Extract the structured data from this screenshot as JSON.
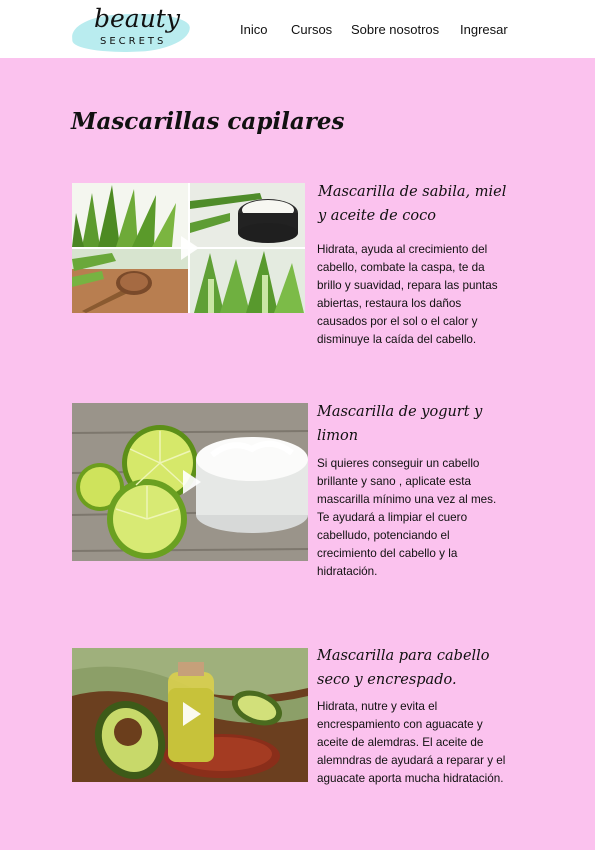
{
  "brand": {
    "name": "beauty",
    "tagline": "SECRETS"
  },
  "nav": {
    "items": [
      "Inico",
      "Cursos",
      "Sobre nosotros",
      "Ingresar"
    ]
  },
  "page": {
    "title": "Mascarillas capilares"
  },
  "colors": {
    "background": "#fbc2ee",
    "header": "#ffffff",
    "logo_splash": "#b9ecef",
    "text": "#111111"
  },
  "cards": [
    {
      "title": "Mascarilla de sabila, miel y aceite de coco",
      "description": "Hidrata, ayuda al crecimiento del cabello, combate la caspa, te da brillo y suavidad, repara las puntas abiertas, restaura los daños causados por el sol o el calor y disminuye la caída del cabello.",
      "play_icon": "play-icon"
    },
    {
      "title": "Mascarilla de yogurt y limon",
      "description": "Si quieres conseguir un cabello brillante y sano , aplicate esta mascarilla mínimo una vez al mes. Te ayudará a limpiar el cuero cabelludo, potenciando el crecimiento del cabello y la hidratación.",
      "play_icon": "play-icon"
    },
    {
      "title": "Mascarilla para cabello seco y encrespado.",
      "description": "Hidrata, nutre y evita el encrespamiento con aguacate y aceite de alemdras. El aceite de alemndras de ayudará a reparar y el aguacate aporta mucha hidratación.",
      "play_icon": "play-icon"
    }
  ]
}
